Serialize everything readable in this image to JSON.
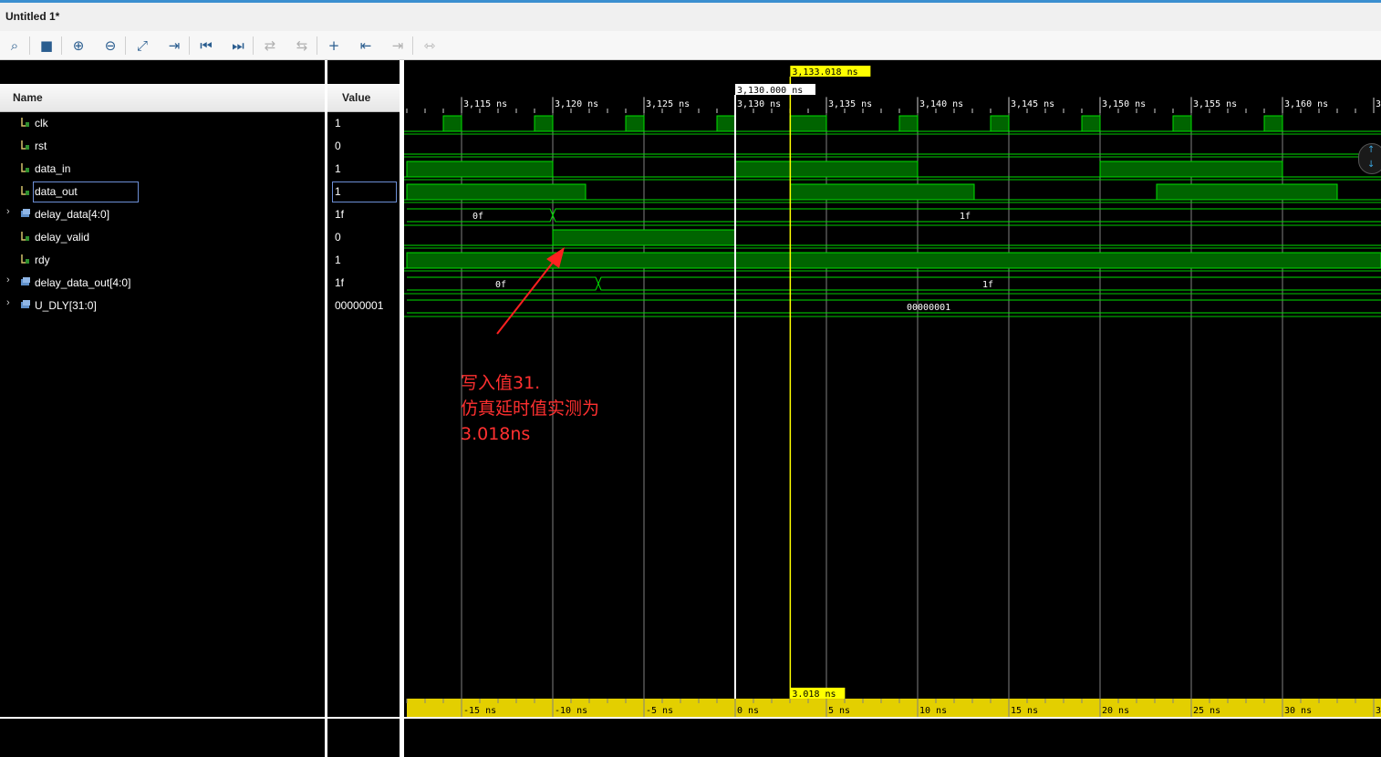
{
  "window": {
    "title": "Untitled 1*"
  },
  "toolbar": [
    {
      "icon": "search-icon",
      "glyph": "⌕",
      "enabled": true
    },
    {
      "icon": "save-icon",
      "glyph": "■",
      "enabled": true
    },
    {
      "icon": "zoom-in-icon",
      "glyph": "⊕",
      "enabled": true
    },
    {
      "icon": "zoom-out-icon",
      "glyph": "⊖",
      "enabled": true
    },
    {
      "icon": "zoom-fit-icon",
      "glyph": "⤢",
      "enabled": true
    },
    {
      "icon": "go-to-cursor-icon",
      "glyph": "⇥",
      "enabled": true
    },
    {
      "icon": "go-to-start-icon",
      "glyph": "⏮",
      "enabled": true
    },
    {
      "icon": "go-to-end-icon",
      "glyph": "⏭",
      "enabled": true
    },
    {
      "icon": "swap-cursors-icon",
      "glyph": "⇄",
      "enabled": false
    },
    {
      "icon": "previous-transition-icon",
      "glyph": "⇆",
      "enabled": false
    },
    {
      "icon": "add-marker-icon",
      "glyph": "+",
      "enabled": true
    },
    {
      "icon": "previous-marker-icon",
      "glyph": "⇤",
      "enabled": true
    },
    {
      "icon": "next-marker-icon",
      "glyph": "⇥",
      "enabled": false
    },
    {
      "icon": "swap-markers-icon",
      "glyph": "⇿",
      "enabled": false
    }
  ],
  "headers": {
    "name": "Name",
    "value": "Value"
  },
  "signals": [
    {
      "name": "clk",
      "value": "1",
      "bus": false
    },
    {
      "name": "rst",
      "value": "0",
      "bus": false
    },
    {
      "name": "data_in",
      "value": "1",
      "bus": false
    },
    {
      "name": "data_out",
      "value": "1",
      "bus": false,
      "selected": true
    },
    {
      "name": "delay_data[4:0]",
      "value": "1f",
      "bus": true
    },
    {
      "name": "delay_valid",
      "value": "0",
      "bus": false
    },
    {
      "name": "rdy",
      "value": "1",
      "bus": false
    },
    {
      "name": "delay_data_out[4:0]",
      "value": "1f",
      "bus": true
    },
    {
      "name": "U_DLY[31:0]",
      "value": "00000001",
      "bus": true
    }
  ],
  "timeline": {
    "top_ticks": [
      3115,
      3120,
      3125,
      3130,
      3135,
      3140,
      3145,
      3150,
      3155,
      3160
    ],
    "top_tick_labels": [
      "3,115 ns",
      "3,120 ns",
      "3,125 ns",
      "3,130 ns",
      "3,135 ns",
      "3,140 ns",
      "3,145 ns",
      "3,150 ns",
      "3,155 ns",
      "3,160 ns",
      "3"
    ],
    "bottom_tick_labels": [
      "-15 ns",
      "-10 ns",
      "-5 ns",
      "0 ns",
      "5 ns",
      "10 ns",
      "15 ns",
      "20 ns",
      "25 ns",
      "30 ns",
      "3"
    ],
    "marker_label": "3,130.000 ns",
    "cursor_label": "3,133.018 ns",
    "delta_label": "3.018 ns",
    "marker_time": 3130.0,
    "cursor_time": 3133.018
  },
  "waves": {
    "clk_high_intervals": [
      [
        3114.0,
        3115.0
      ],
      [
        3119.0,
        3120.0
      ],
      [
        3124.0,
        3125.0
      ],
      [
        3129.0,
        3130.0
      ],
      [
        3133.0,
        3135.0
      ],
      [
        3139.0,
        3140.0
      ],
      [
        3144.0,
        3145.0
      ],
      [
        3149.0,
        3150.0
      ],
      [
        3154.0,
        3155.0
      ],
      [
        3159.0,
        3160.0
      ]
    ],
    "data_in_high": [
      [
        3112.0,
        3120.0
      ],
      [
        3130.0,
        3140.0
      ],
      [
        3150.0,
        3160.0
      ]
    ],
    "data_out_high": [
      [
        3112.0,
        3121.8
      ],
      [
        3133.018,
        3143.1
      ],
      [
        3153.1,
        3163.0
      ]
    ],
    "delay_valid_high": [
      [
        3120.0,
        3130.0
      ]
    ],
    "rdy_high": [
      [
        3112.0,
        3166.0
      ]
    ],
    "delay_data": [
      {
        "value": "0f"
      },
      {
        "value": "1f"
      }
    ],
    "delay_data_out": [
      {
        "value": "0f"
      },
      {
        "value": "1f"
      }
    ],
    "u_dly": [
      {
        "value": "00000001"
      }
    ]
  },
  "annotation": {
    "lines": [
      "写入值31.",
      "仿真延时值实测为",
      "3.018ns"
    ],
    "color": "#ff3030"
  },
  "colors": {
    "wave_fill": "#006400",
    "wave_line": "#00e000",
    "cursor": "#ffff00",
    "marker": "#ffffff",
    "grid": "#808080",
    "ruler": "#e3cf00"
  }
}
